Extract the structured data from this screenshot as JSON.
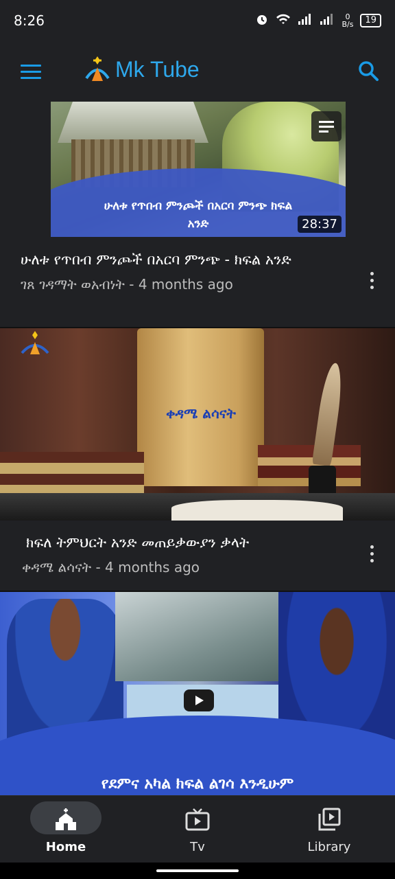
{
  "status": {
    "time": "8:26",
    "net_speed_value": "0",
    "net_speed_unit": "B/s",
    "battery": "19"
  },
  "app": {
    "title": "Mk Tube"
  },
  "videos": [
    {
      "thumbnail_caption": "ሁለቱ የጥበብ ምንጮች በአርባ ምንጭ ክፍል አንድ",
      "duration": "28:37",
      "title": "ሁለቱ የጥበብ ምንጮች በአርባ ምንጭ - ክፍል አንድ",
      "channel": "ገጸ ገዳማት ወአብነት",
      "age": "4 months ago"
    },
    {
      "thumbnail_caption": "ቀዳሜ ልሳናት",
      "title": "ክፍለ ትምህርት አንድ መጠይቃውያን ቃላት",
      "channel": "ቀዳሜ ልሳናት",
      "age": "4 months ago"
    },
    {
      "thumbnail_caption": "የደምና አካል ክፍል ልገሳ እንዲሁም"
    }
  ],
  "nav": {
    "items": [
      {
        "label": "Home",
        "icon": "church-icon",
        "active": true
      },
      {
        "label": "Tv",
        "icon": "tv-icon",
        "active": false
      },
      {
        "label": "Library",
        "icon": "library-icon",
        "active": false
      }
    ]
  },
  "colors": {
    "background": "#202124",
    "accent": "#2ea8ec"
  }
}
